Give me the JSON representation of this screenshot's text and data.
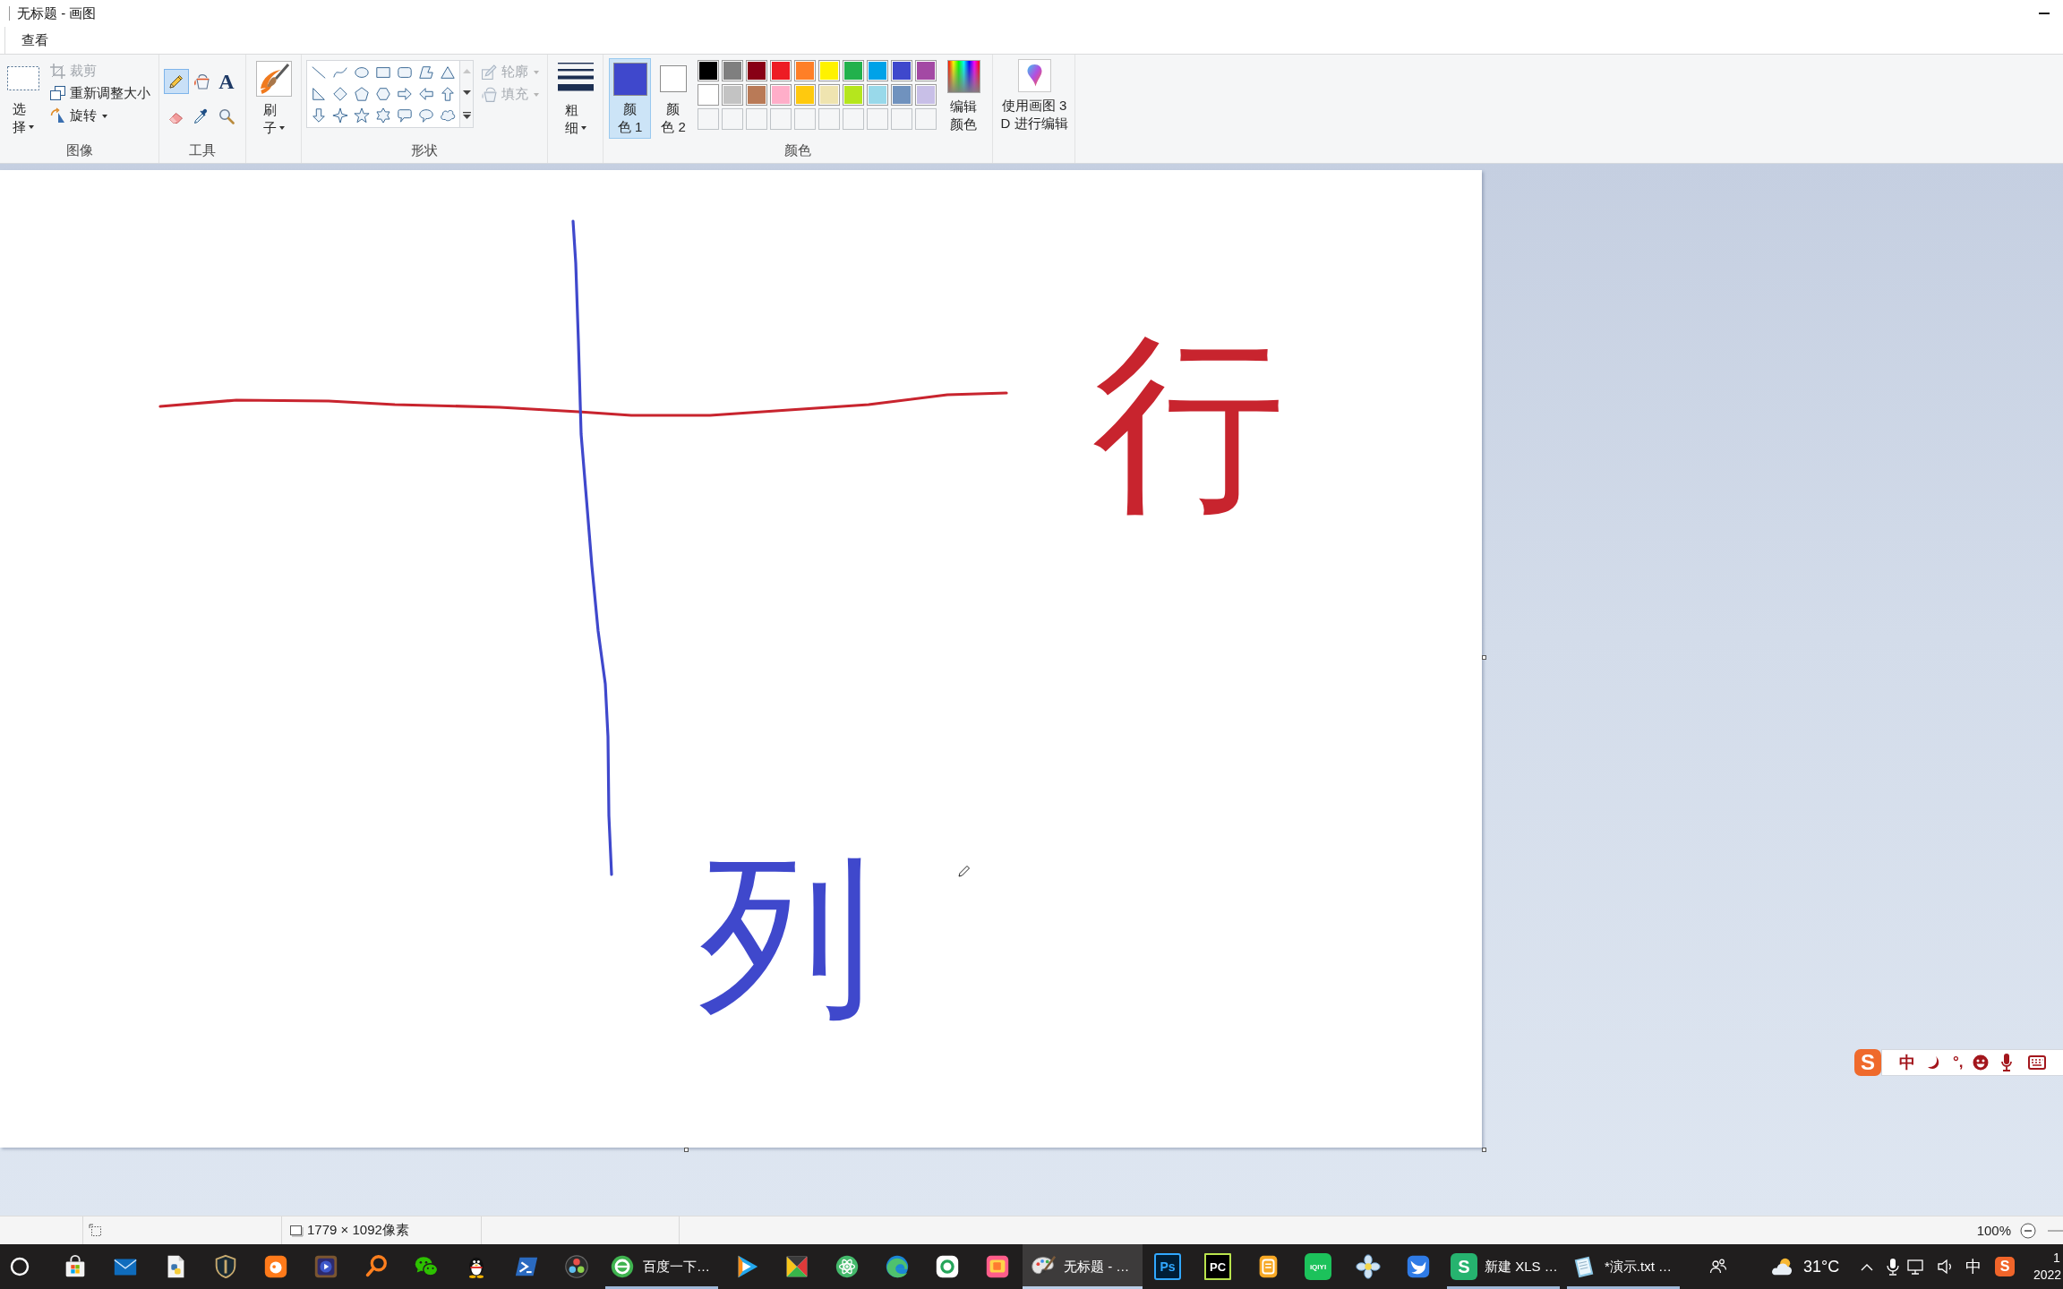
{
  "window": {
    "title": "无标题 - 画图"
  },
  "tabs": [
    {
      "label": "查看"
    }
  ],
  "ribbon": {
    "image_group": {
      "label": "图像",
      "select": {
        "label_lines": [
          "选",
          "择"
        ]
      },
      "commands": [
        {
          "kind": "crop",
          "label": "裁剪",
          "disabled": true,
          "dropdown": false
        },
        {
          "kind": "resize",
          "label": "重新调整大小",
          "disabled": false,
          "dropdown": false
        },
        {
          "kind": "rotate",
          "label": "旋转",
          "disabled": false,
          "dropdown": true
        }
      ]
    },
    "tools_group": {
      "label": "工具",
      "tools": [
        {
          "kind": "pencil",
          "selected": true
        },
        {
          "kind": "fill",
          "selected": false
        },
        {
          "kind": "text",
          "glyph": "A",
          "selected": false
        },
        {
          "kind": "eraser",
          "selected": false
        },
        {
          "kind": "picker",
          "selected": false
        },
        {
          "kind": "magnifier",
          "selected": false
        }
      ]
    },
    "brushes": {
      "label_lines": [
        "刷",
        "子"
      ]
    },
    "shapes_group": {
      "label": "形状",
      "options": [
        {
          "kind": "outline",
          "label": "轮廓",
          "disabled": true
        },
        {
          "kind": "fill",
          "label": "填充",
          "disabled": true
        }
      ]
    },
    "size": {
      "label_lines": [
        "粗",
        "细"
      ]
    },
    "colors_group": {
      "label": "颜色",
      "current": [
        {
          "label_lines": [
            "颜",
            "色 1"
          ],
          "color": "#3f48cc",
          "selected": true
        },
        {
          "label_lines": [
            "颜",
            "色 2"
          ],
          "color": "#ffffff",
          "selected": false
        }
      ],
      "palette": [
        {
          "kind": "swatch",
          "color": "#000000"
        },
        {
          "kind": "swatch",
          "color": "#7f7f7f"
        },
        {
          "kind": "swatch",
          "color": "#880015"
        },
        {
          "kind": "swatch",
          "color": "#ed1c24"
        },
        {
          "kind": "swatch",
          "color": "#ff7f27"
        },
        {
          "kind": "swatch",
          "color": "#fff200"
        },
        {
          "kind": "swatch",
          "color": "#22b14c"
        },
        {
          "kind": "swatch",
          "color": "#00a2e8"
        },
        {
          "kind": "swatch",
          "color": "#3f48cc"
        },
        {
          "kind": "swatch",
          "color": "#a349a4"
        },
        {
          "kind": "swatch",
          "color": "#ffffff"
        },
        {
          "kind": "swatch",
          "color": "#c3c3c3"
        },
        {
          "kind": "swatch",
          "color": "#b97a57"
        },
        {
          "kind": "swatch",
          "color": "#ffaec9"
        },
        {
          "kind": "swatch",
          "color": "#ffc90e"
        },
        {
          "kind": "swatch",
          "color": "#efe4b0"
        },
        {
          "kind": "swatch",
          "color": "#b5e61d"
        },
        {
          "kind": "swatch",
          "color": "#99d9ea"
        },
        {
          "kind": "swatch",
          "color": "#7092be"
        },
        {
          "kind": "swatch",
          "color": "#c8bfe7"
        },
        {
          "kind": "empty"
        },
        {
          "kind": "empty"
        },
        {
          "kind": "empty"
        },
        {
          "kind": "empty"
        },
        {
          "kind": "empty"
        },
        {
          "kind": "empty"
        },
        {
          "kind": "empty"
        },
        {
          "kind": "empty"
        },
        {
          "kind": "empty"
        },
        {
          "kind": "empty"
        }
      ],
      "edit": {
        "label_lines": [
          "编辑",
          "颜色"
        ]
      }
    },
    "paint3d": {
      "label_lines": [
        "使用画图 3",
        "D 进行编辑"
      ]
    }
  },
  "canvas": {
    "marks": [
      {
        "kind": "row",
        "text": "行",
        "color": "#c8242e"
      },
      {
        "kind": "column",
        "text": "列",
        "color": "#3f48cc"
      }
    ]
  },
  "ime_bar": {
    "logo": "S",
    "mode": "中",
    "punctuation": "°,"
  },
  "status_bar": {
    "size": "1779 × 1092像素",
    "zoom": "100%"
  },
  "taskbar": {
    "apps": [
      {
        "kind": "store",
        "running": false,
        "selected": false
      },
      {
        "kind": "mail",
        "running": false,
        "selected": false
      },
      {
        "kind": "document",
        "running": false,
        "selected": false
      },
      {
        "kind": "emblem",
        "running": false,
        "selected": false
      },
      {
        "kind": "fish-tile",
        "running": false,
        "selected": false
      },
      {
        "kind": "media",
        "running": false,
        "selected": false
      },
      {
        "kind": "magnifier",
        "running": false,
        "selected": false
      },
      {
        "kind": "chat",
        "running": false,
        "selected": false
      },
      {
        "kind": "penguin",
        "running": false,
        "selected": false
      },
      {
        "kind": "terminal",
        "running": false,
        "selected": false
      },
      {
        "kind": "dots-circle",
        "running": false,
        "selected": false
      },
      {
        "kind": "browser",
        "label": "百度一下…",
        "running": true,
        "selected": false
      },
      {
        "kind": "play",
        "running": false,
        "selected": false
      },
      {
        "kind": "triangles",
        "running": false,
        "selected": false
      },
      {
        "kind": "atom",
        "running": false,
        "selected": false
      },
      {
        "kind": "swirl",
        "running": false,
        "selected": false
      },
      {
        "kind": "ring-tile",
        "running": false,
        "selected": false
      },
      {
        "kind": "square-tile",
        "running": false,
        "selected": false
      },
      {
        "kind": "paint",
        "label": "无标题 - …",
        "running": true,
        "selected": true
      },
      {
        "kind": "ps",
        "glyph": "Ps",
        "running": false,
        "selected": false
      },
      {
        "kind": "pc",
        "glyph": "PC",
        "running": false,
        "selected": false
      },
      {
        "kind": "notebook",
        "running": false,
        "selected": false
      },
      {
        "kind": "iqiyi",
        "glyph": "iQIYI",
        "running": false,
        "selected": false
      },
      {
        "kind": "flower",
        "running": false,
        "selected": false
      },
      {
        "kind": "bird",
        "running": false,
        "selected": false
      },
      {
        "kind": "wps",
        "glyph": "S",
        "label": "新建 XLS …",
        "running": true,
        "selected": false
      },
      {
        "kind": "notepad",
        "label": "*演示.txt …",
        "running": true,
        "selected": false
      }
    ],
    "tray": {
      "temperature": "31°C",
      "input_mode": "中",
      "ime_logo": "S",
      "time": "1",
      "date": "2022"
    }
  }
}
